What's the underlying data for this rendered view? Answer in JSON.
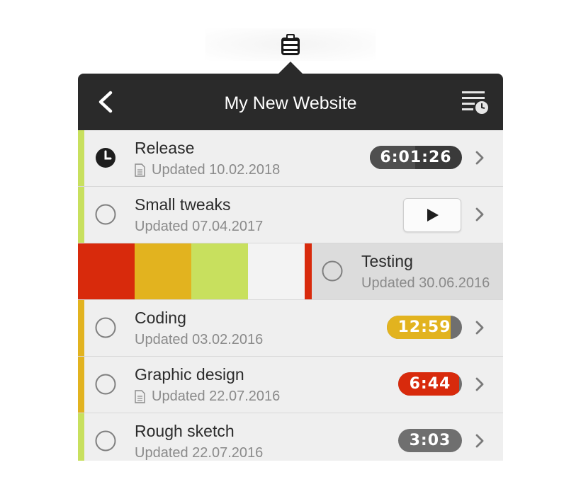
{
  "header": {
    "title": "My New Website",
    "back_icon": "chevron-left-icon",
    "menu_icon": "list-clock-icon"
  },
  "menubar_icon": "clipboard-stack-icon",
  "colors": {
    "header_bg": "#2a2a2a",
    "row_bg": "#efefef",
    "lime": "#c8e05e",
    "amber": "#e2b31f",
    "red": "#d82a0c",
    "dark_badge": "#3a3a3a",
    "gray_badge": "#6f6f6f"
  },
  "tasks": [
    {
      "name": "Release",
      "updated": "Updated 10.02.2018",
      "has_doc": true,
      "status": "running-clock",
      "timer": "6:01:26",
      "timer_color": "#3a3a3a"
    },
    {
      "name": "Small tweaks",
      "updated": "Updated 07.04.2017",
      "has_doc": false,
      "status": "idle",
      "action": "play-icon"
    },
    {
      "name": "Testing",
      "updated": "Updated 30.06.2016",
      "has_doc": false,
      "status": "idle",
      "swiped": true,
      "swipe_colors": [
        "#d82a0c",
        "#e2b31f",
        "#c8e05e",
        "#f3f3f3"
      ]
    },
    {
      "name": "Coding",
      "updated": "Updated 03.02.2016",
      "has_doc": false,
      "status": "idle",
      "timer": "12:59",
      "timer_color": "#e2b31f"
    },
    {
      "name": "Graphic design",
      "updated": "Updated 22.07.2016",
      "has_doc": true,
      "status": "idle",
      "timer": "6:44",
      "timer_color": "#d82a0c"
    },
    {
      "name": "Rough sketch",
      "updated": "Updated 22.07.2016",
      "has_doc": false,
      "status": "idle",
      "timer": "3:03",
      "timer_color": "#6f6f6f"
    }
  ]
}
